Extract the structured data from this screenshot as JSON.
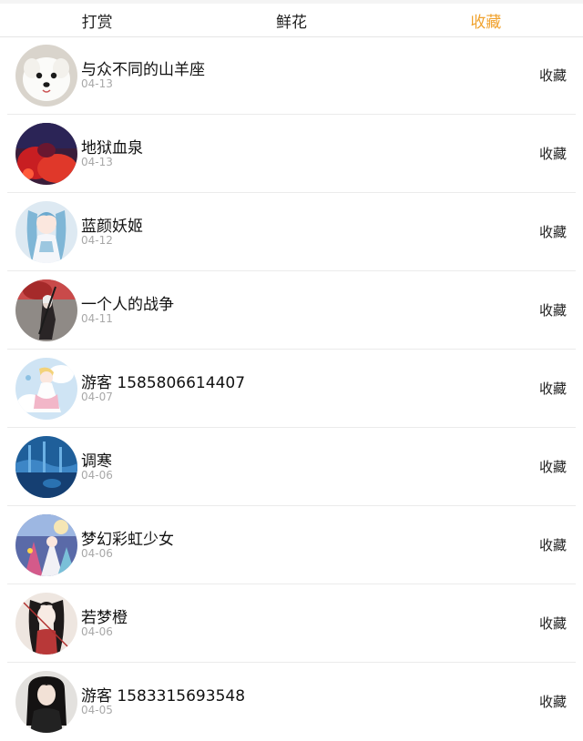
{
  "tabs": [
    {
      "label": "打赏",
      "active": false
    },
    {
      "label": "鲜花",
      "active": false
    },
    {
      "label": "收藏",
      "active": true
    }
  ],
  "accent_color": "#f0a22e",
  "list": [
    {
      "name": "与众不同的山羊座",
      "date": "04-13",
      "action": "收藏",
      "avatar": "white-puppy-avatar"
    },
    {
      "name": "地狱血泉",
      "date": "04-13",
      "action": "收藏",
      "avatar": "red-dark-avatar"
    },
    {
      "name": "蓝颜妖姬",
      "date": "04-12",
      "action": "收藏",
      "avatar": "anime-girl-blue-avatar"
    },
    {
      "name": "一个人的战争",
      "date": "04-11",
      "action": "收藏",
      "avatar": "dark-warrior-avatar"
    },
    {
      "name": "游客 1585806614407",
      "date": "04-07",
      "action": "收藏",
      "avatar": "anime-angel-avatar"
    },
    {
      "name": "调寒",
      "date": "04-06",
      "action": "收藏",
      "avatar": "blue-ocean-avatar"
    },
    {
      "name": "梦幻彩虹少女",
      "date": "04-06",
      "action": "收藏",
      "avatar": "colorful-anime-avatar"
    },
    {
      "name": "若梦橙",
      "date": "04-06",
      "action": "收藏",
      "avatar": "ink-portrait-avatar"
    },
    {
      "name": "游客 1583315693548",
      "date": "04-05",
      "action": "收藏",
      "avatar": "girl-photo-avatar"
    }
  ]
}
